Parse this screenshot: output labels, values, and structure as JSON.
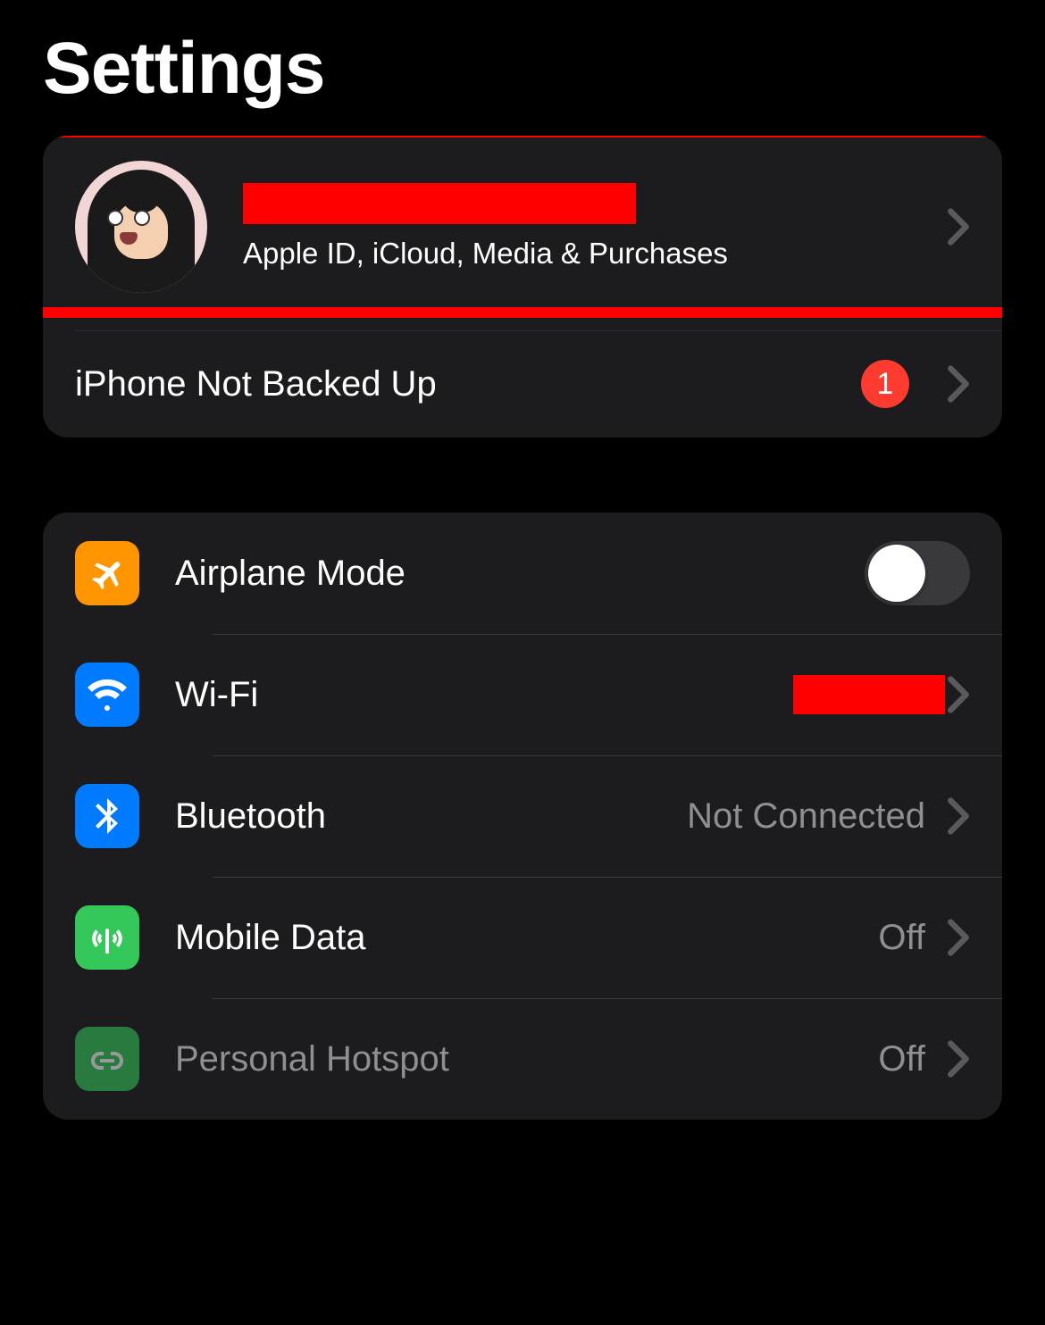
{
  "page_title": "Settings",
  "profile": {
    "subtitle": "Apple ID, iCloud, Media & Purchases",
    "name_redacted": true
  },
  "notification": {
    "label": "iPhone Not Backed Up",
    "badge": "1"
  },
  "section_connectivity": {
    "airplane": {
      "label": "Airplane Mode",
      "toggle_on": false
    },
    "wifi": {
      "label": "Wi-Fi",
      "value_redacted": true
    },
    "bluetooth": {
      "label": "Bluetooth",
      "value": "Not Connected"
    },
    "mobile_data": {
      "label": "Mobile Data",
      "value": "Off"
    },
    "personal_hotspot": {
      "label": "Personal Hotspot",
      "value": "Off"
    }
  },
  "colors": {
    "accent_orange": "#ff9500",
    "accent_blue": "#007aff",
    "accent_green": "#34c759",
    "badge_red": "#ff3b30",
    "highlight_red": "#ff0000"
  }
}
